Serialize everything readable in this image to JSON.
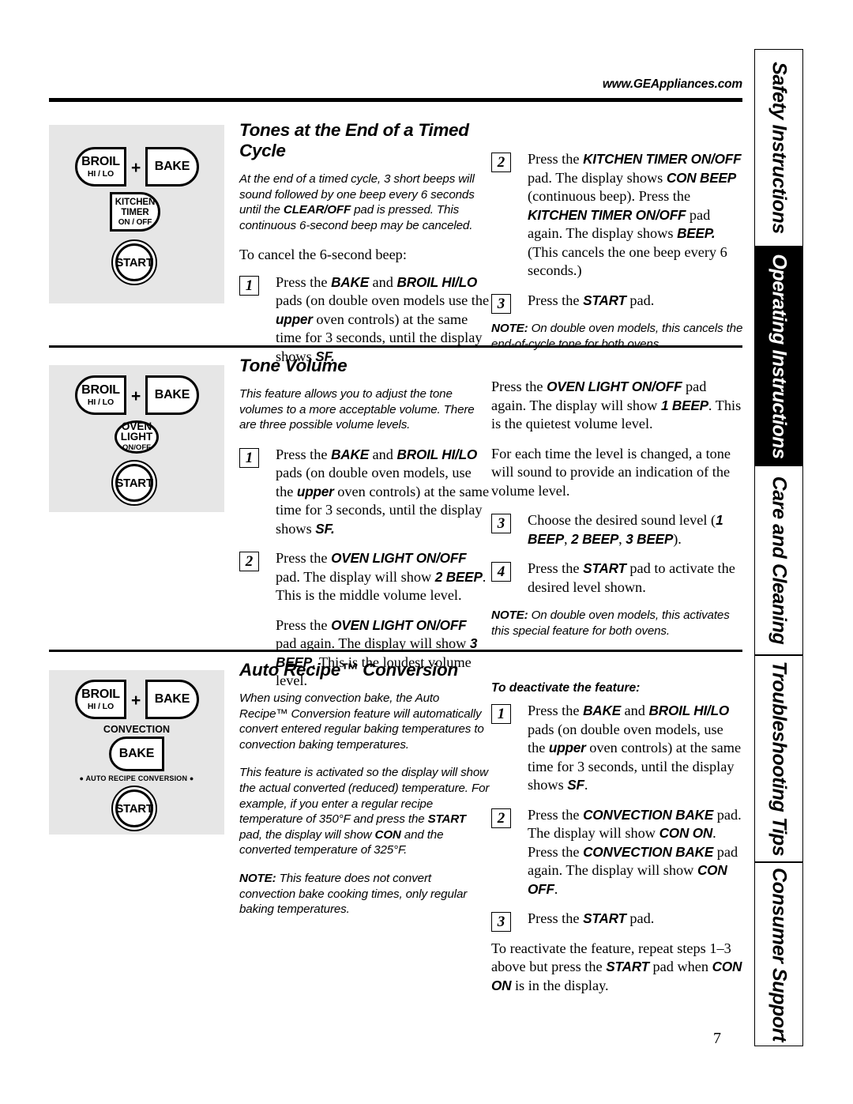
{
  "header": {
    "site_url": "www.GEAppliances.com"
  },
  "page_number": "7",
  "sidebar": {
    "tabs": [
      {
        "label": "Safety Instructions",
        "active": false
      },
      {
        "label": "Operating Instructions",
        "active": true
      },
      {
        "label": "Care and Cleaning",
        "active": false
      },
      {
        "label": "Troubleshooting Tips",
        "active": false
      },
      {
        "label": "Consumer Support",
        "active": false
      }
    ]
  },
  "sections": [
    {
      "id": "tones",
      "title": "Tones at the End of a Timed Cycle",
      "pads": {
        "broil": {
          "line1": "BROIL",
          "line2": "HI / LO"
        },
        "plus": "+",
        "bake": {
          "line1": "BAKE"
        },
        "second": {
          "line1": "KITCHEN",
          "line2": "TIMER",
          "line3": "ON / OFF"
        },
        "start": "START"
      },
      "intro": "At the end of a timed cycle, 3 short beeps will sound followed by one beep every 6 seconds until the CLEAR/OFF pad is pressed. This continuous 6-second beep may be canceled.",
      "lead": "To cancel the 6-second beep:",
      "steps_left": [
        {
          "num": "1",
          "text": "Press the BAKE and BROIL HI/LO pads (on double oven models use the upper oven controls) at the same time for 3 seconds, until the display shows SF."
        }
      ],
      "steps_right": [
        {
          "num": "2",
          "text": "Press the KITCHEN TIMER ON/OFF pad. The display shows CON BEEP (continuous beep). Press the KITCHEN TIMER ON/OFF pad again. The display shows BEEP. (This cancels the one beep every 6 seconds.)"
        },
        {
          "num": "3",
          "text": "Press the START pad."
        }
      ],
      "note": "NOTE: On double oven models, this cancels the end-of-cycle tone for both ovens."
    },
    {
      "id": "tone-volume",
      "title": "Tone Volume",
      "pads": {
        "broil": {
          "line1": "BROIL",
          "line2": "HI / LO"
        },
        "plus": "+",
        "bake": {
          "line1": "BAKE"
        },
        "second": {
          "line1": "OVEN",
          "line2": "LIGHT",
          "line3": "ON/OFF"
        },
        "start": "START"
      },
      "intro": "This feature allows you to adjust the tone volumes to a more acceptable volume. There are three possible volume levels.",
      "steps_left": [
        {
          "num": "1",
          "text": "Press the BAKE and BROIL HI/LO pads (on double oven models, use the upper oven controls) at the same time for 3 seconds, until the display shows SF."
        },
        {
          "num": "2",
          "text": "Press the OVEN LIGHT ON/OFF pad. The display will show 2 BEEP. This is the middle volume level."
        }
      ],
      "para_left": "Press the OVEN LIGHT ON/OFF pad again. The display will show 3 BEEP. This is the loudest volume level.",
      "para_right_1": "Press the OVEN LIGHT ON/OFF pad again. The display will show 1 BEEP. This is the quietest volume level.",
      "para_right_2": "For each time the level is changed, a tone will sound to provide an indication of the volume level.",
      "steps_right": [
        {
          "num": "3",
          "text": "Choose the desired sound level (1 BEEP, 2 BEEP, 3 BEEP)."
        },
        {
          "num": "4",
          "text": "Press the START pad to activate the desired level shown."
        }
      ],
      "note": "NOTE: On double oven models, this activates this special feature for both ovens."
    },
    {
      "id": "auto-recipe",
      "title": "Auto Recipe™ Conversion",
      "pads": {
        "broil": {
          "line1": "BROIL",
          "line2": "HI / LO"
        },
        "plus": "+",
        "bake": {
          "line1": "BAKE"
        },
        "convection_caption": "CONVECTION",
        "convection_bake": "BAKE",
        "auto_caption": "● AUTO RECIPE CONVERSION ●",
        "start": "START"
      },
      "intro_1": "When using convection bake, the Auto Recipe™ Conversion feature will automatically convert entered regular baking temperatures to convection baking temperatures.",
      "intro_2": "This feature is activated so the display will show the actual converted (reduced) temperature. For example, if you enter a regular recipe temperature of 350°F and press the START pad, the display will show CON and the converted temperature of 325°F.",
      "note_left": "NOTE: This feature does not convert convection bake cooking times, only regular baking temperatures.",
      "subhead_right": "To deactivate the feature:",
      "steps_right": [
        {
          "num": "1",
          "text": "Press the BAKE and BROIL HI/LO pads (on double oven models, use the upper oven controls) at the same time for 3 seconds, until the display shows SF."
        },
        {
          "num": "2",
          "text": "Press the CONVECTION BAKE pad. The display will show CON ON. Press the CONVECTION BAKE pad again. The display will show CON OFF."
        },
        {
          "num": "3",
          "text": "Press the START pad."
        }
      ],
      "closing_right": "To reactivate the feature, repeat steps 1–3 above but press the START pad when CON ON is in the display."
    }
  ]
}
